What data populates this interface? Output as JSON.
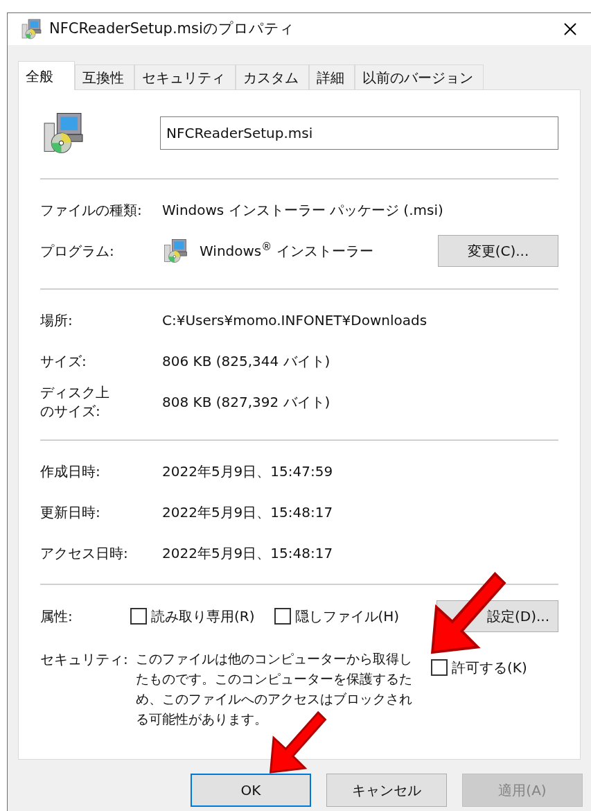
{
  "window": {
    "title": "NFCReaderSetup.msiのプロパティ"
  },
  "tabs": [
    {
      "label": "全般",
      "selected": true
    },
    {
      "label": "互換性",
      "selected": false
    },
    {
      "label": "セキュリティ",
      "selected": false
    },
    {
      "label": "カスタム",
      "selected": false
    },
    {
      "label": "詳細",
      "selected": false
    },
    {
      "label": "以前のバージョン",
      "selected": false
    }
  ],
  "file": {
    "name": "NFCReaderSetup.msi"
  },
  "sections": [
    [
      {
        "kind": "text",
        "label": "ファイルの種類:",
        "value": "Windows インストーラー パッケージ (.msi)"
      },
      {
        "kind": "program",
        "label": "プログラム:",
        "value": "Windows$^{®}$ インストーラー",
        "button": "変更(C)..."
      }
    ],
    [
      {
        "kind": "text",
        "label": "場所:",
        "value": "C:¥Users¥momo.INFONET¥Downloads"
      },
      {
        "kind": "text",
        "label": "サイズ:",
        "value": "806 KB (825,344 バイト)"
      },
      {
        "kind": "narrow",
        "label": "ディスク上のサイズ:",
        "value": "808 KB (827,392 バイト)"
      }
    ],
    [
      {
        "kind": "text",
        "label": "作成日時:",
        "value": "2022年5月9日、15:47:59"
      },
      {
        "kind": "text",
        "label": "更新日時:",
        "value": "2022年5月9日、15:48:17"
      },
      {
        "kind": "text",
        "label": "アクセス日時:",
        "value": "2022年5月9日、15:48:17"
      }
    ]
  ],
  "attributes": {
    "label": "属性:",
    "checkboxes": [
      {
        "label": "読み取り専用(R)",
        "checked": false
      },
      {
        "label": "隠しファイル(H)",
        "checked": false
      }
    ],
    "button": "設定(D)..."
  },
  "security": {
    "label": "セキュリティ:",
    "text": "このファイルは他のコンピューターから取得したものです。このコンピューターを保護するため、このファイルへのアクセスはブロックされる可能性があります。",
    "checkbox": {
      "label": "許可する(K)",
      "checked": false
    }
  },
  "buttons": [
    {
      "label": "OK",
      "kind": "default"
    },
    {
      "label": "キャンセル",
      "kind": "normal"
    },
    {
      "label": "適用(A)",
      "kind": "disabled"
    }
  ]
}
